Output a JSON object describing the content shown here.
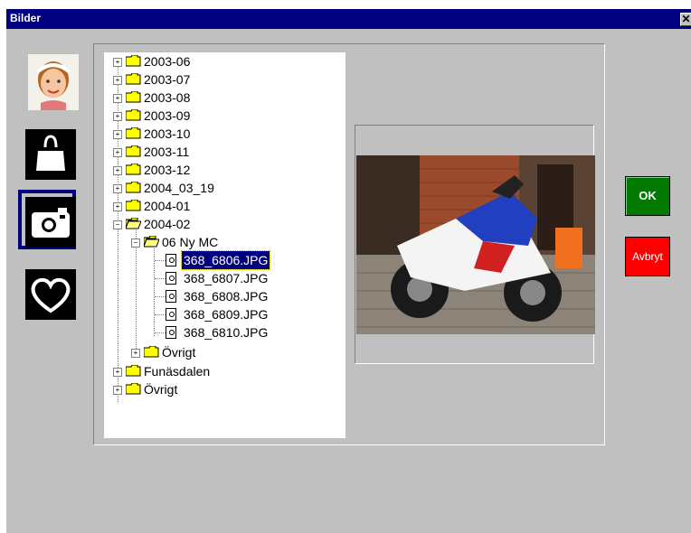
{
  "window": {
    "title": "Bilder",
    "close_label": "✕"
  },
  "sidebar": {
    "items": [
      {
        "name": "photo-thumbnail"
      },
      {
        "name": "shopping-bag"
      },
      {
        "name": "camera",
        "selected": true
      },
      {
        "name": "heart"
      }
    ]
  },
  "tree": {
    "folders": [
      "2003-06",
      "2003-07",
      "2003-08",
      "2003-09",
      "2003-10",
      "2003-11",
      "2003-12",
      "2004_03_19",
      "2004-01",
      "2004-02"
    ],
    "subfolder": "06 Ny MC",
    "files": [
      "368_6806.JPG",
      "368_6807.JPG",
      "368_6808.JPG",
      "368_6809.JPG",
      "368_6810.JPG"
    ],
    "selected_file": "368_6806.JPG",
    "sub_other": "Övrigt",
    "root_after": [
      "Funäsdalen",
      "Övrigt"
    ]
  },
  "buttons": {
    "ok": "OK",
    "cancel": "Avbryt"
  },
  "colors": {
    "titlebar": "#000080",
    "ok": "#007a00",
    "cancel": "#ff0000"
  }
}
